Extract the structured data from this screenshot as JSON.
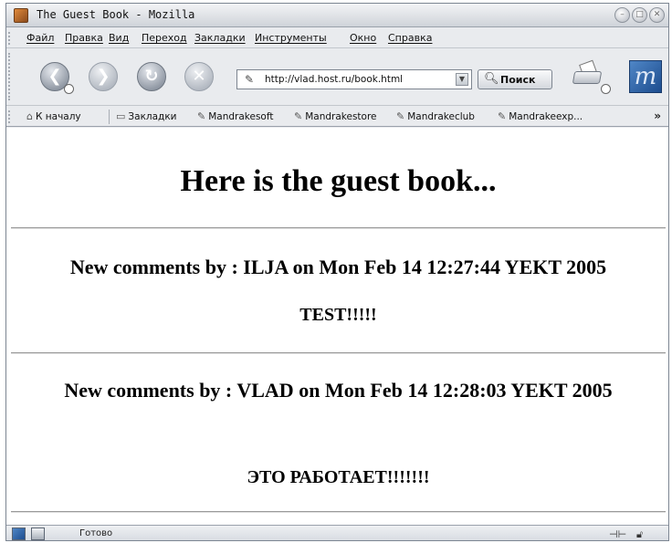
{
  "window": {
    "title": "The Guest Book - Mozilla",
    "controls": {
      "minimize": "–",
      "maximize": "□",
      "close": "✕"
    }
  },
  "menu": [
    "Файл",
    "Правка",
    "Вид",
    "Переход",
    "Закладки",
    "Инструменты",
    "Окно",
    "Справка"
  ],
  "toolbar": {
    "back": "❮",
    "forward": "❯",
    "reload": "↻",
    "stop": "✕",
    "url": "http://vlad.host.ru/book.html",
    "url_drop": "▼",
    "search_label": "Поиск",
    "brand": "m"
  },
  "personal_bar": {
    "items": [
      "К началу",
      "Закладки",
      "Mandrakesoft",
      "Mandrakestore",
      "Mandrakeclub",
      "Mandrakeexp..."
    ],
    "more": "»"
  },
  "page": {
    "heading": "Here is the guest book...",
    "entries": [
      {
        "header": "New comments by : ILJA on Mon Feb 14 12:27:44 YEKT 2005",
        "message": "TEST!!!!!"
      },
      {
        "header": "New comments by : VLAD on Mon Feb 14 12:28:03 YEKT 2005",
        "message": "ЭТО РАБОТАЕТ!!!!!!!"
      }
    ]
  },
  "status": {
    "text": "Готово"
  },
  "icons": {
    "app": "mozilla-icon",
    "home": "home-icon",
    "folder": "folder-icon",
    "bookmark": "bookmark-icon",
    "search": "magnifier-icon",
    "print": "printer-icon"
  },
  "colors": {
    "chrome_bg": "#e9ebee",
    "logo_blue": "#1d4d8f"
  }
}
